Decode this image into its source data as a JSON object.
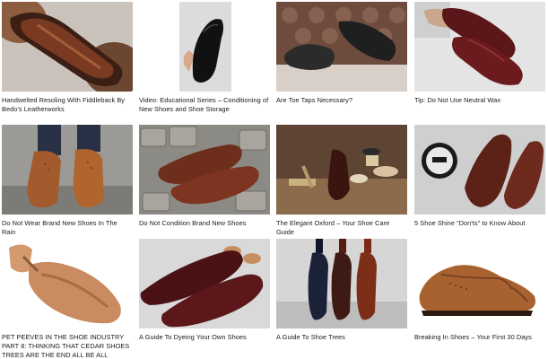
{
  "articles": [
    {
      "title": "Handwelted Resoling With Fiddleback By Bedo's Leatherworks",
      "thumbnail_icon": "resoled-shoe-sole-photo"
    },
    {
      "title": "Video: Educational Series – Conditioning of New Shoes and Shoe Storage",
      "thumbnail_icon": "black-oxford-in-hand-photo"
    },
    {
      "title": "Are Toe Taps Necessary?",
      "thumbnail_icon": "shoe-soles-on-chesterfield-photo"
    },
    {
      "title": "Tip: Do Not Use Neutral Wax",
      "thumbnail_icon": "burgundy-shoes-held-photo"
    },
    {
      "title": "Do Not Wear Brand New Shoes In The Rain",
      "thumbnail_icon": "tan-brogues-worn-photo"
    },
    {
      "title": "Do Not Condition Brand New Shoes",
      "thumbnail_icon": "brown-oxfords-on-cobblestone-photo"
    },
    {
      "title": "The Elegant Oxford – Your Shoe Care Guide",
      "thumbnail_icon": "oxford-with-care-products-photo"
    },
    {
      "title": "5 Shoe Shine “Don'ts” to Know About",
      "thumbnail_icon": "saphir-tin-with-brogues-photo"
    },
    {
      "title": "PET PEEVES IN THE SHOE INDUSTRY PART 8: THINKING THAT CEDAR SHOES TREES ARE THE END ALL BE ALL",
      "thumbnail_icon": "cedar-shoe-tree-photo"
    },
    {
      "title": "A Guide To Dyeing Your Own Shoes",
      "thumbnail_icon": "burgundy-wingtips-photo"
    },
    {
      "title": "A Guide To Shoe Trees",
      "thumbnail_icon": "three-shoes-with-trees-photo"
    },
    {
      "title": "Breaking In Shoes – Your First 30 Days",
      "thumbnail_icon": "tan-wingtip-photo"
    }
  ],
  "colors": {
    "background": "#ffffff",
    "text": "#1a1a1a"
  }
}
